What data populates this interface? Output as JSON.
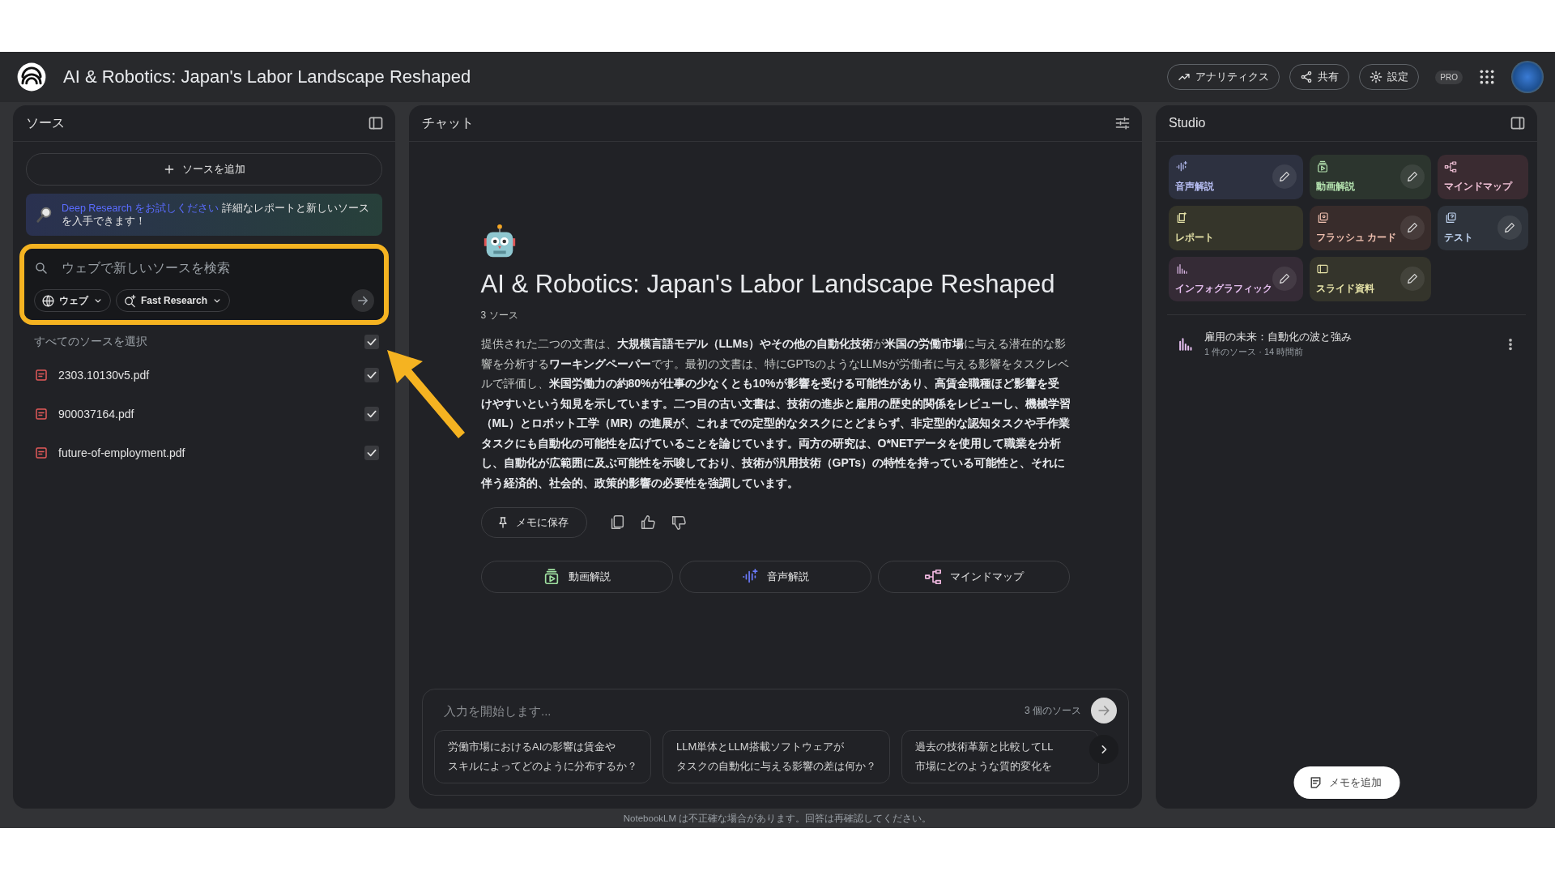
{
  "header": {
    "title": "AI & Robotics: Japan's Labor Landscape Reshaped",
    "buttons": [
      {
        "kind": "analytics",
        "label": "アナリティクス"
      },
      {
        "kind": "share",
        "label": "共有"
      },
      {
        "kind": "settings",
        "label": "設定"
      }
    ],
    "badge": "PRO"
  },
  "sources": {
    "title": "ソース",
    "add_button": "ソースを追加",
    "promo": {
      "link": "Deep Research をお試しください",
      "text": "詳細なレポートと新しいソースを入手できます！"
    },
    "search": {
      "placeholder": "ウェブで新しいソースを検索",
      "chips": [
        {
          "kind": "web",
          "label": "ウェブ"
        },
        {
          "kind": "research",
          "label": "Fast Research"
        }
      ]
    },
    "select_all": {
      "label": "すべてのソースを選択",
      "checked": true
    },
    "items": [
      {
        "name": "2303.10130v5.pdf",
        "checked": true
      },
      {
        "name": "900037164.pdf",
        "checked": true
      },
      {
        "name": "future-of-employment.pdf",
        "checked": true
      }
    ]
  },
  "chat": {
    "title": "チャット",
    "notebook_title": "AI & Robotics: Japan's Labor Landscape Reshaped",
    "source_count": "3 ソース",
    "summary": "提供された二つの文書は、**大規模言語モデル（LLMs）やその他の自動化技術**が**米国の労働市場**に与える潜在的な影響を分析する**ワーキングペーパー**です。最初の文書は、特にGPTsのようなLLMsが労働者に与える影響をタスクレベルで評価し、**米国労働力の約80%が仕事の少なくとも10%が影響を受ける可能性があり、高賃金職種ほど影響を受けやすいという知見を示しています。二つ目の古い文書は、技術の進歩と雇用の歴史的関係をレビューし、機械学習（ML）とロボット工学（MR）の進展が、これまでの定型的なタスクにとどまらず、非定型的な認知タスクや手作業タスクにも自動化の可能性を広げていることを論じています。両方の研究は、O*NETデータを使用して職業を分析し、自動化が広範囲に及ぶ可能性を示唆しており、技術が汎用技術（GPTs）の特性を持っている可能性と、それに伴う経済的、社会的、政策的影響の必要性を強調しています。**",
    "save_button": "メモに保存",
    "actions": [
      {
        "kind": "video",
        "label": "動画解説"
      },
      {
        "kind": "audio",
        "label": "音声解説"
      },
      {
        "kind": "mindmap",
        "label": "マインドマップ"
      }
    ],
    "input": {
      "placeholder": "入力を開始します...",
      "source_count": "3 個のソース"
    },
    "suggestions": [
      {
        "lines": [
          "労働市場におけるAIの影響は賃金や",
          "スキルによってどのように分布するか？"
        ]
      },
      {
        "lines": [
          "LLM単体とLLM搭載ソフトウェアが",
          "タスクの自動化に与える影響の差は何か？"
        ]
      },
      {
        "lines": [
          "過去の技術革新と比較してLL",
          "市場にどのような質的変化を"
        ]
      }
    ]
  },
  "studio": {
    "title": "Studio",
    "tiles": [
      {
        "kind": "audio",
        "label": "音声解説",
        "color": "#2d3140",
        "editable": true
      },
      {
        "kind": "video",
        "label": "動画解説",
        "color": "#2c352e",
        "editable": true
      },
      {
        "kind": "mindmap",
        "label": "マインドマップ",
        "color": "#3a2b31",
        "editable": false
      },
      {
        "kind": "report",
        "label": "レポート",
        "color": "#35352a",
        "editable": false
      },
      {
        "kind": "flashcards",
        "label": "フラッシュ カード",
        "color": "#382c2b",
        "editable": true
      },
      {
        "kind": "quiz",
        "label": "テスト",
        "color": "#2e333b",
        "editable": true
      },
      {
        "kind": "infographic",
        "label": "インフォグラフィック",
        "color": "#352b36",
        "editable": true
      },
      {
        "kind": "slides",
        "label": "スライド資料",
        "color": "#34342b",
        "editable": true
      }
    ],
    "notes": [
      {
        "title": "雇用の未来：自動化の波と強み",
        "meta": "1 件のソース · 14 時間前"
      }
    ],
    "add_note": "メモを追加"
  },
  "footer": "NotebookLM は不正確な場合があります。回答は再確認してください。"
}
